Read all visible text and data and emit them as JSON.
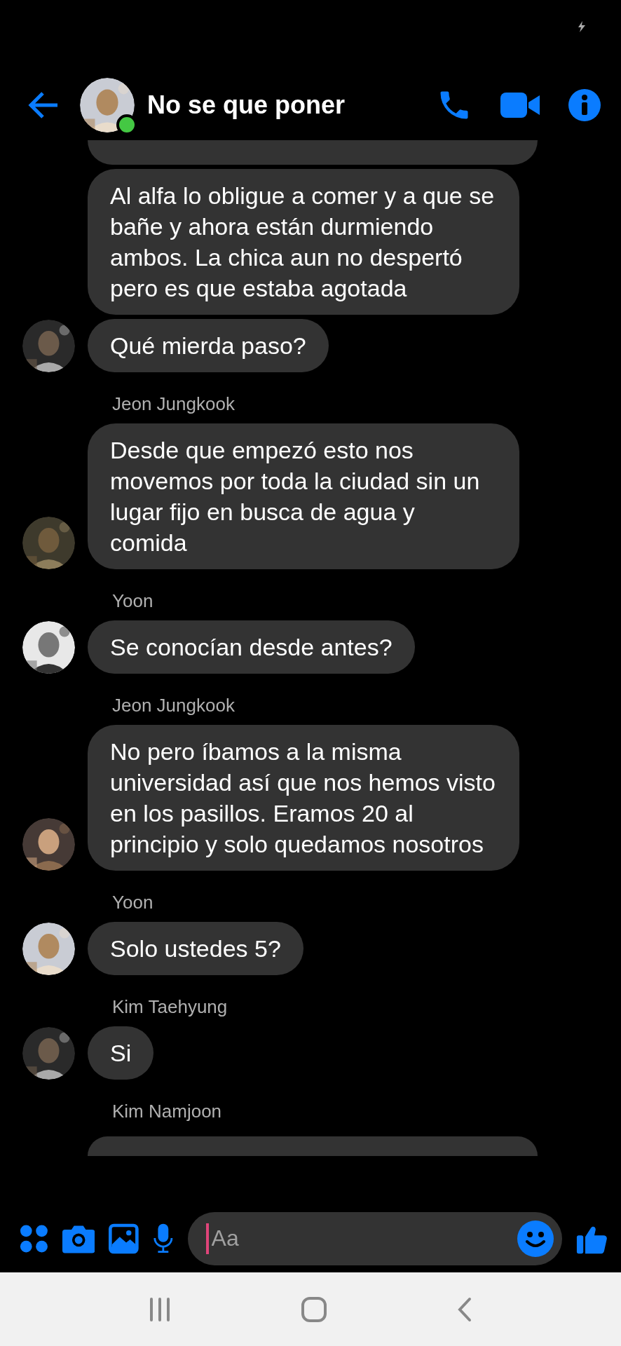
{
  "header": {
    "title": "No se que poner",
    "online": true
  },
  "messages": [
    {
      "kind": "fragment-top"
    },
    {
      "kind": "message",
      "text": "Al alfa lo obligue a comer y a que se bañe y ahora están durmiendo ambos. La chica aun no despertó pero es que estaba agotada",
      "avatar": false
    },
    {
      "kind": "message",
      "text": "Qué mierda paso?",
      "avatar": true
    },
    {
      "kind": "message",
      "sender": "Jeon Jungkook",
      "text": "Desde que empezó esto nos movemos por toda la ciudad sin un lugar fijo en busca de agua y comida",
      "avatar": true
    },
    {
      "kind": "message",
      "sender": "Yoon",
      "text": "Se conocían desde antes?",
      "avatar": true
    },
    {
      "kind": "message",
      "sender": "Jeon Jungkook",
      "text": "No pero íbamos a la misma universidad así que nos hemos visto en los pasillos. Eramos 20 al principio y solo quedamos nosotros",
      "avatar": true
    },
    {
      "kind": "message",
      "sender": "Yoon",
      "text": "Solo ustedes 5?",
      "avatar": true
    },
    {
      "kind": "message",
      "sender": "Kim Taehyung",
      "text": "Si",
      "avatar": true
    },
    {
      "kind": "sender",
      "sender": "Kim Namjoon"
    },
    {
      "kind": "fragment-bottom"
    }
  ],
  "composer": {
    "placeholder": "Aa"
  }
}
